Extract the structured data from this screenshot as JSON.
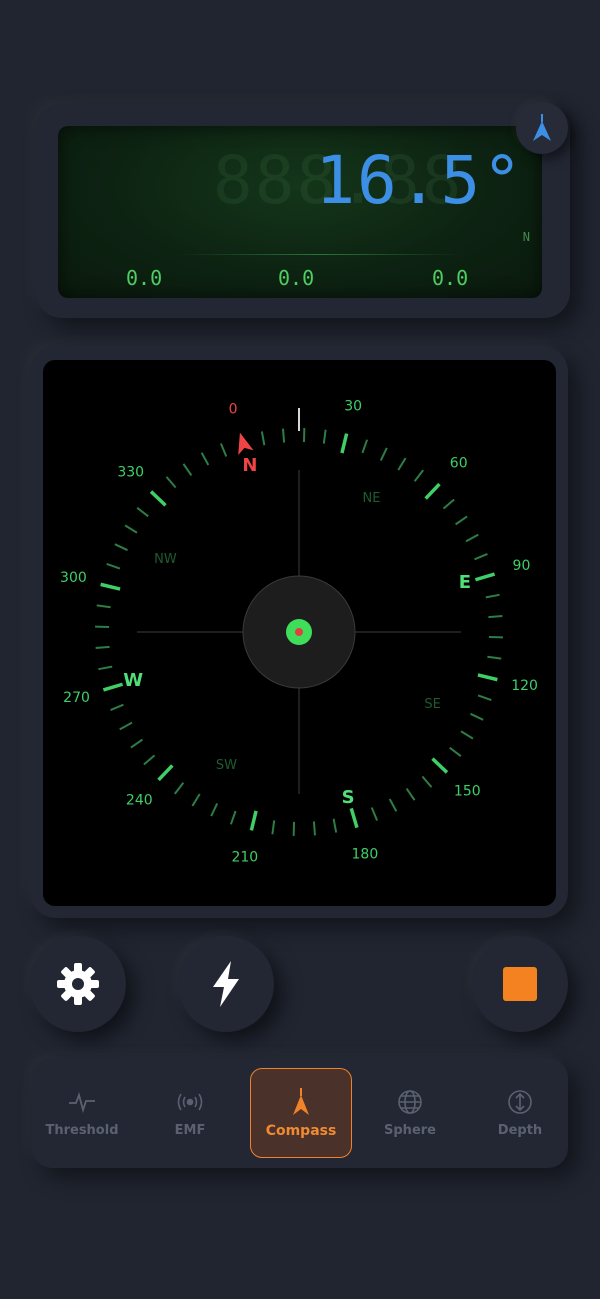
{
  "display": {
    "heading_ghost": "888.88",
    "heading": "16.5°",
    "direction": "N",
    "axis_values": [
      "0.0",
      "0.0",
      "0.0"
    ]
  },
  "compass": {
    "degree_labels": [
      "0",
      "30",
      "60",
      "90",
      "120",
      "150",
      "180",
      "210",
      "240",
      "270",
      "300",
      "330"
    ],
    "cardinals": {
      "N": "N",
      "E": "E",
      "S": "S",
      "W": "W"
    },
    "intercardinals": {
      "NE": "NE",
      "SE": "SE",
      "SW": "SW",
      "NW": "NW"
    },
    "rotation_deg": -16.5
  },
  "controls": {
    "settings_icon": "gear-icon",
    "flash_icon": "lightning-icon",
    "stop_icon": "stop-square-icon"
  },
  "tabs": [
    {
      "label": "Threshold",
      "icon": "pulse-icon"
    },
    {
      "label": "EMF",
      "icon": "signal-waves-icon"
    },
    {
      "label": "Compass",
      "icon": "compass-arrow-icon"
    },
    {
      "label": "Sphere",
      "icon": "globe-icon"
    },
    {
      "label": "Depth",
      "icon": "depth-arrows-icon"
    }
  ],
  "colors": {
    "accent_orange": "#f0822a",
    "readout_blue": "#3d8fe6",
    "compass_green": "#3fcf66",
    "north_red": "#ef4444"
  }
}
